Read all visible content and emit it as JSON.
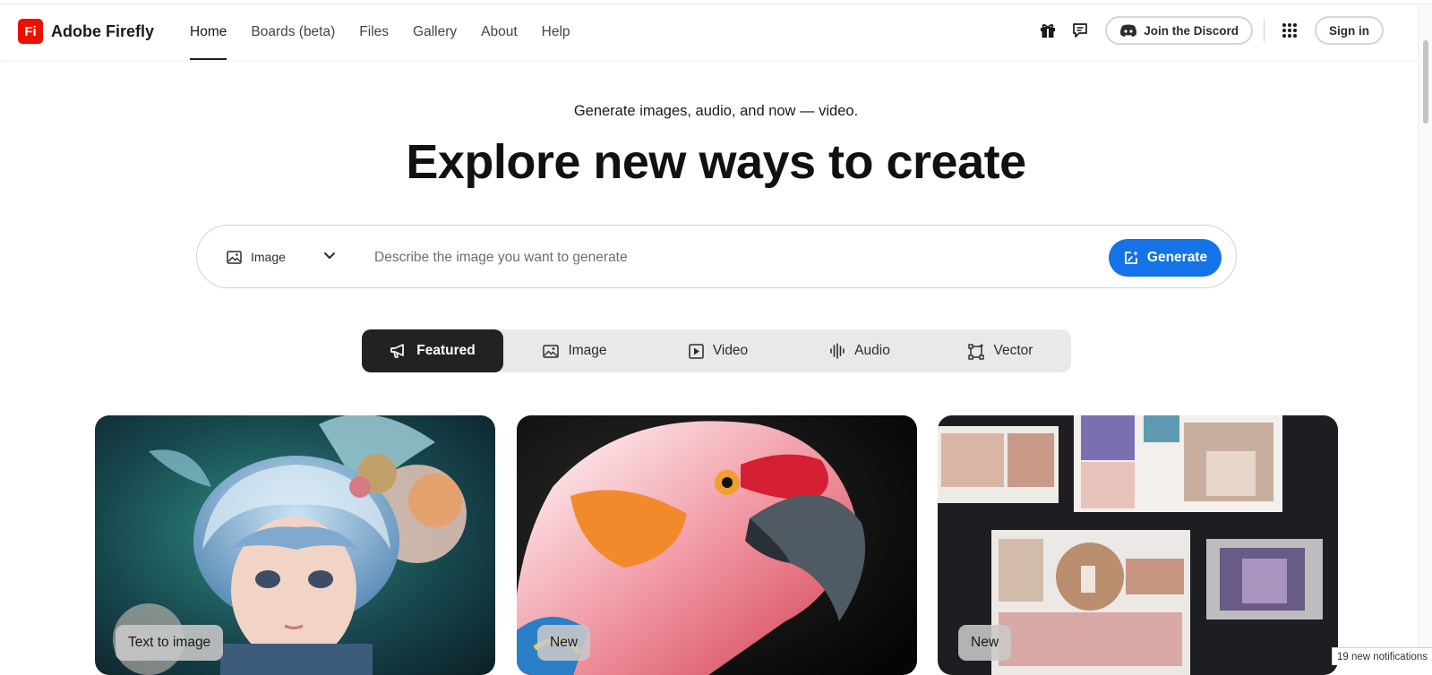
{
  "brand": {
    "logo_text": "Fi",
    "name": "Adobe Firefly",
    "logo_color": "#eb1000"
  },
  "nav": {
    "items": [
      {
        "label": "Home",
        "active": true
      },
      {
        "label": "Boards (beta)",
        "active": false
      },
      {
        "label": "Files",
        "active": false
      },
      {
        "label": "Gallery",
        "active": false
      },
      {
        "label": "About",
        "active": false
      },
      {
        "label": "Help",
        "active": false
      }
    ]
  },
  "header_actions": {
    "gift_icon": "gift-icon",
    "feedback_icon": "chat-feedback-icon",
    "discord_label": "Join the Discord",
    "apps_icon": "app-grid-icon",
    "sign_in_label": "Sign in"
  },
  "hero": {
    "tagline": "Generate images, audio, and now — video.",
    "title": "Explore new ways to create"
  },
  "prompt": {
    "type_value": "Image",
    "placeholder": "Describe the image you want to generate",
    "generate_label": "Generate",
    "accent_color": "#1473e6"
  },
  "tabs": [
    {
      "label": "Featured",
      "icon": "megaphone-icon",
      "active": true
    },
    {
      "label": "Image",
      "icon": "image-icon",
      "active": false
    },
    {
      "label": "Video",
      "icon": "video-play-icon",
      "active": false
    },
    {
      "label": "Audio",
      "icon": "audio-waveform-icon",
      "active": false
    },
    {
      "label": "Vector",
      "icon": "vector-shape-icon",
      "active": false
    }
  ],
  "cards": [
    {
      "badge": "Text to image",
      "subject": "blue-haired anime character with flowers"
    },
    {
      "badge": "New",
      "subject": "colorful parrot portrait"
    },
    {
      "badge": "New",
      "subject": "moodboard collage of product photos"
    }
  ],
  "notifications": "19 new notifications"
}
